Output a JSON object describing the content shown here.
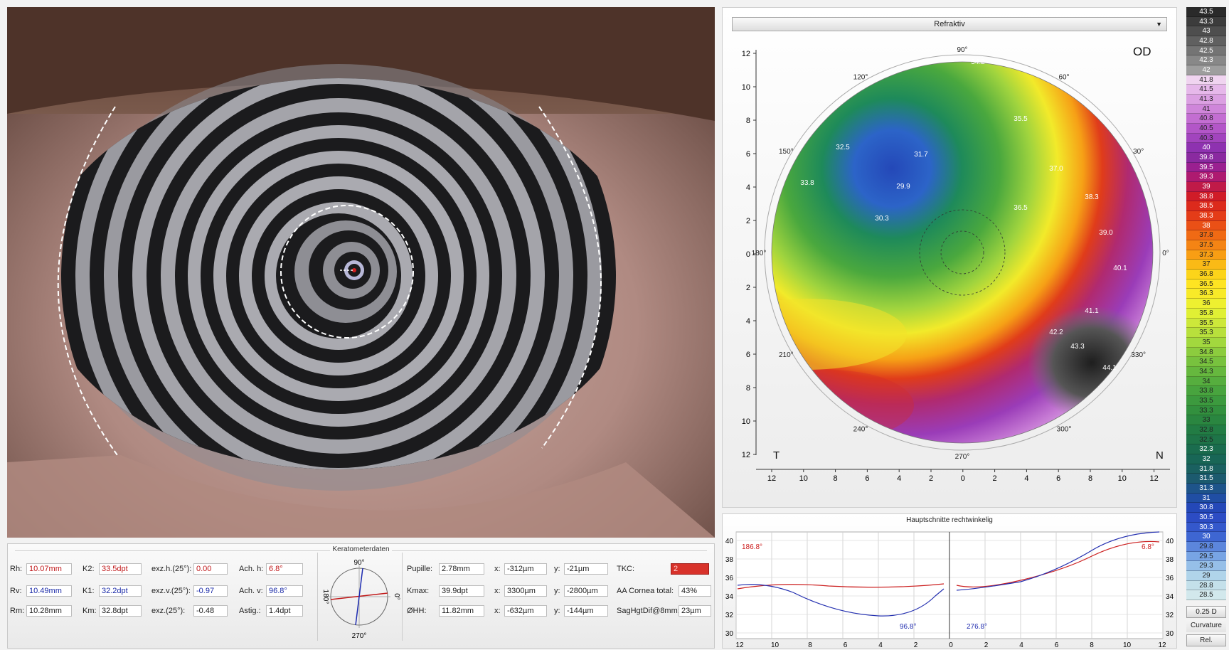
{
  "map": {
    "dropdown_value": "Refraktiv",
    "eye": "OD",
    "label_left": "T",
    "label_right": "N",
    "angles": [
      "90°",
      "60°",
      "30°",
      "0°",
      "330°",
      "300°",
      "270°",
      "240°",
      "210°",
      "180°",
      "150°",
      "120°"
    ],
    "y_ticks": [
      "12",
      "10",
      "8",
      "6",
      "4",
      "2",
      "0",
      "2",
      "4",
      "6",
      "8",
      "10",
      "12"
    ],
    "x_ticks": [
      "12",
      "10",
      "8",
      "6",
      "4",
      "2",
      "0",
      "2",
      "4",
      "6",
      "8",
      "10",
      "12"
    ],
    "values": [
      "29.9",
      "30.3",
      "31.7",
      "32.5",
      "33.8",
      "35.5",
      "37.0",
      "38.3",
      "39.0",
      "40.1",
      "41.1",
      "42.2",
      "43.3",
      "44.1",
      "36.5",
      "34.2"
    ]
  },
  "scale": {
    "values": [
      "43.5",
      "43.3",
      "43",
      "42.8",
      "42.5",
      "42.3",
      "42",
      "41.8",
      "41.5",
      "41.3",
      "41",
      "40.8",
      "40.5",
      "40.3",
      "40",
      "39.8",
      "39.5",
      "39.3",
      "39",
      "38.8",
      "38.5",
      "38.3",
      "38",
      "37.8",
      "37.5",
      "37.3",
      "37",
      "36.8",
      "36.5",
      "36.3",
      "36",
      "35.8",
      "35.5",
      "35.3",
      "35",
      "34.8",
      "34.5",
      "34.3",
      "34",
      "33.8",
      "33.5",
      "33.3",
      "33",
      "32.8",
      "32.5",
      "32.3",
      "32",
      "31.8",
      "31.5",
      "31.3",
      "31",
      "30.8",
      "30.5",
      "30.3",
      "30",
      "29.8",
      "29.5",
      "29.3",
      "29",
      "28.8",
      "28.5"
    ],
    "colors": [
      "#2a2a2a",
      "#3c3c3c",
      "#4e4e4e",
      "#606060",
      "#747474",
      "#888888",
      "#9e9e9e",
      "#f0d4f0",
      "#e6b8ea",
      "#dba0e2",
      "#cf86da",
      "#c36ed2",
      "#b356c8",
      "#a244be",
      "#8e32b0",
      "#8a2aa0",
      "#9a2090",
      "#ae1a70",
      "#c01a48",
      "#d01c28",
      "#dc2a1c",
      "#e43c18",
      "#ea5016",
      "#f06a14",
      "#f48414",
      "#f89e14",
      "#faba16",
      "#fcd41a",
      "#fee422",
      "#f8ea28",
      "#eef030",
      "#e0f034",
      "#cde83a",
      "#b8e03c",
      "#a2d83e",
      "#8ccc3e",
      "#78c23e",
      "#66b83e",
      "#56ae3e",
      "#48a43e",
      "#3c9a3e",
      "#32903e",
      "#2a8640",
      "#227c44",
      "#1e7448",
      "#1a6c4e",
      "#186656",
      "#1a6060",
      "#1c5a6e",
      "#1e548a",
      "#204ea4",
      "#2448b8",
      "#2c4cc4",
      "#3458cc",
      "#3e66d2",
      "#5c86dc",
      "#78a4e4",
      "#96bfe8",
      "#b0d4ea",
      "#c4e0ea",
      "#d2e8ec"
    ],
    "step_label": "0.25 D",
    "mode_label": "Curvature",
    "rel_label": "Rel."
  },
  "profile": {
    "title": "Hauptschnitte rechtwinkelig",
    "y_ticks": [
      "40",
      "38",
      "36",
      "34",
      "32",
      "30"
    ],
    "x_ticks": [
      "12",
      "10",
      "8",
      "6",
      "4",
      "2",
      "0",
      "2",
      "4",
      "6",
      "8",
      "10",
      "12"
    ],
    "angle_red_left": "186.8°",
    "angle_red_right": "6.8°",
    "angle_blue_left": "96.8°",
    "angle_blue_right": "276.8°"
  },
  "kerato": {
    "title": "Keratometerdaten",
    "rh_label": "Rh:",
    "rh_value": "10.07mm",
    "rv_label": "Rv:",
    "rv_value": "10.49mm",
    "rm_label": "Rm:",
    "rm_value": "10.28mm",
    "k2_label": "K2:",
    "k2_value": "33.5dpt",
    "k1_label": "K1:",
    "k1_value": "32.2dpt",
    "km_label": "Km:",
    "km_value": "32.8dpt",
    "exzh_label": "exz.h.(25°):",
    "exzh_value": "0.00",
    "exzv_label": "exz.v.(25°):",
    "exzv_value": "-0.97",
    "exz_label": "exz.(25°):",
    "exz_value": "-0.48",
    "achh_label": "Ach. h:",
    "achh_value": "6.8°",
    "achv_label": "Ach. v:",
    "achv_value": "96.8°",
    "astig_label": "Astig.:",
    "astig_value": "1.4dpt",
    "compass_top": "90°",
    "compass_left": "180°",
    "compass_right": "0°",
    "compass_bottom": "270°",
    "pupille_label": "Pupille:",
    "pupille_value": "2.78mm",
    "kmax_label": "Kmax:",
    "kmax_value": "39.9dpt",
    "ohh_label": "ØHH:",
    "ohh_value": "11.82mm",
    "x1_label": "x:",
    "x1_value": "-312µm",
    "x2_label": "x:",
    "x2_value": "3300µm",
    "x3_label": "x:",
    "x3_value": "-632µm",
    "y1_label": "y:",
    "y1_value": "-21µm",
    "y2_label": "y:",
    "y2_value": "-2800µm",
    "y3_label": "y:",
    "y3_value": "-144µm",
    "tkc_label": "TKC:",
    "tkc_value": "2",
    "aa_label": "AA Cornea total:",
    "aa_value": "43%",
    "sag_label": "SagHgtDif@8mm:",
    "sag_value": "23µm"
  }
}
